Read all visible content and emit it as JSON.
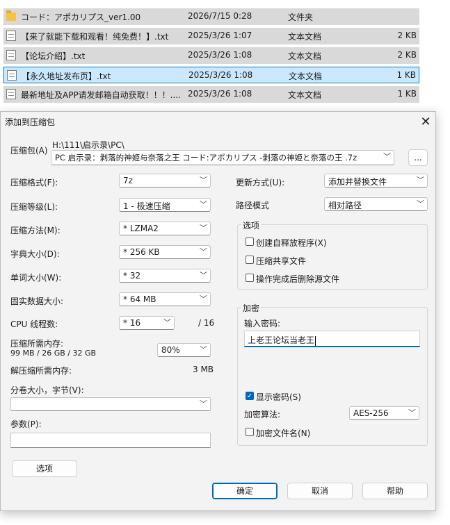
{
  "files": [
    {
      "name": "コード：アポカリプス_ver1.00",
      "date": "2026/7/15 0:28",
      "type": "文件夹",
      "size": "",
      "icon": "folder-icon"
    },
    {
      "name": "【来了就能下载和观看！纯免费！】.txt",
      "date": "2025/3/26 1:07",
      "type": "文本文档",
      "size": "2 KB",
      "icon": "text-file-icon"
    },
    {
      "name": "【论坛介绍】.txt",
      "date": "2025/3/26 1:08",
      "type": "文本文档",
      "size": "2 KB",
      "icon": "text-file-icon"
    },
    {
      "name": "【永久地址发布页】.txt",
      "date": "2025/3/26 1:08",
      "type": "文本文档",
      "size": "1 KB",
      "icon": "text-file-icon",
      "selected": true
    },
    {
      "name": "最新地址及APP请发邮箱自动获取！！！....",
      "date": "2025/3/26 1:08",
      "type": "文本文档",
      "size": "1 KB",
      "icon": "text-file-icon"
    }
  ],
  "dialog": {
    "title": "添加到压缩包",
    "close_glyph": "✕",
    "archive": {
      "label": "压缩包(A)",
      "path": "H:\\111\\启示录\\PC\\",
      "value": "PC 启示录：剥落的神姫与奈落之王 コード:アポカリプス -剥落の神姫と奈落の王 .7z",
      "browse": "..."
    },
    "left": {
      "format": {
        "label": "压缩格式(F):",
        "value": "7z"
      },
      "level": {
        "label": "压缩等级(L):",
        "value": "1 - 极速压缩"
      },
      "method": {
        "label": "压缩方法(M):",
        "value": "*  LZMA2"
      },
      "dict": {
        "label": "字典大小(D):",
        "value": "*  256 KB"
      },
      "word": {
        "label": "单词大小(W):",
        "value": "*  32"
      },
      "solid": {
        "label": "固实数据大小:",
        "value": "*  64 MB"
      },
      "cpu": {
        "label": "CPU 线程数:",
        "value": "*  16",
        "max": "/ 16"
      },
      "mem_compress": {
        "label": "压缩所需内存:",
        "detail": "99 MB / 26 GB / 32 GB",
        "value": "80%"
      },
      "mem_decompress": {
        "label": "解压缩所需内存:",
        "value": "3 MB"
      },
      "split": {
        "label": "分卷大小，字节(V):",
        "value": ""
      },
      "params": {
        "label": "参数(P):",
        "value": ""
      },
      "options_button": "选项"
    },
    "right": {
      "update": {
        "label": "更新方式(U):",
        "value": "添加并替换文件"
      },
      "path_mode": {
        "label": "路径模式",
        "value": "相对路径"
      },
      "options": {
        "title": "选项",
        "sfx": "创建自释放程序(X)",
        "shared": "压缩共享文件",
        "delete_after": "操作完成后删除源文件"
      },
      "encryption": {
        "title": "加密",
        "pwd_label": "输入密码:",
        "pwd_value": "上老王论坛当老王",
        "show_pwd": "显示密码(S)",
        "algo_label": "加密算法:",
        "algo_value": "AES-256",
        "encrypt_names": "加密文件名(N)"
      }
    },
    "buttons": {
      "ok": "确定",
      "cancel": "取消",
      "help": "帮助"
    }
  },
  "colors": {
    "accent": "#0067c0",
    "selection": "#cce8ff",
    "row_bg": "#d9d9d9",
    "dialog_bg": "#f3f3f3"
  }
}
